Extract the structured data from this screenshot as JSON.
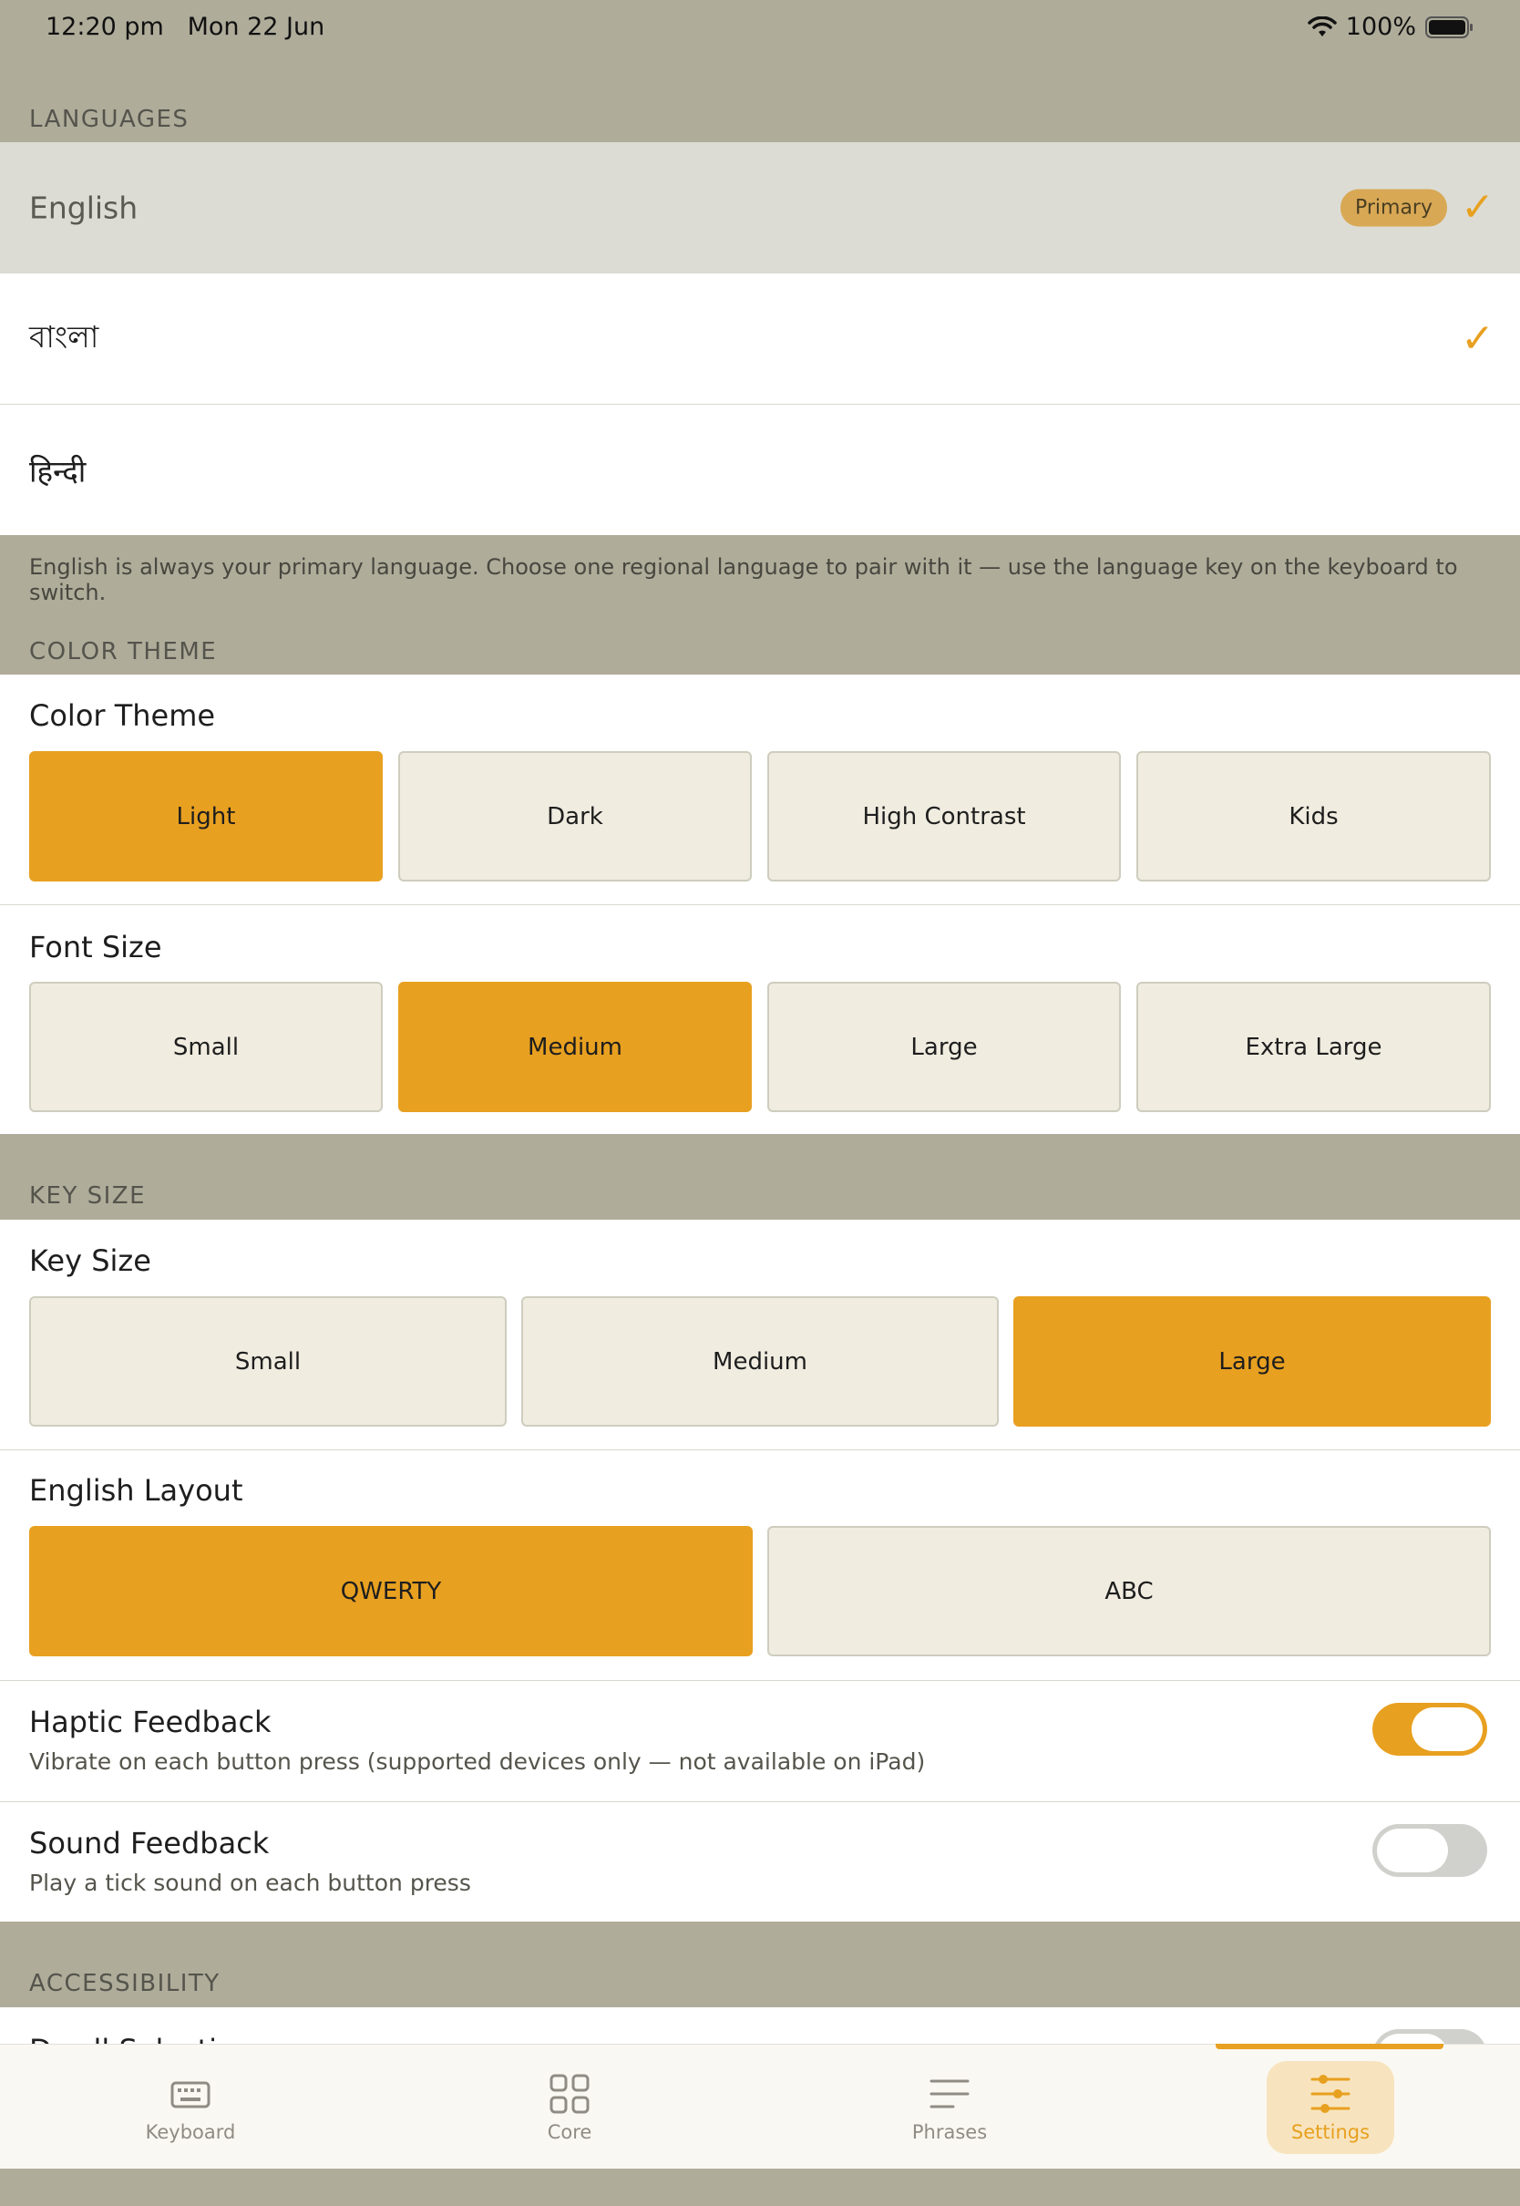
{
  "status_bar": {
    "time": "12:20 pm",
    "date": "Mon 22 Jun",
    "battery": "100%"
  },
  "languages": {
    "section_label": "LANGUAGES",
    "items": [
      {
        "name": "English",
        "badge": "Primary",
        "checked": true
      },
      {
        "name": "বাংলা",
        "checked": true
      },
      {
        "name": "हिन्दी",
        "checked": false
      }
    ],
    "check_glyph": "✓",
    "note": "English is always your primary language. Choose one regional language to pair with it — use the language key on the keyboard to switch."
  },
  "color_theme": {
    "section_label": "COLOR THEME",
    "title": "Color Theme",
    "options": [
      "Light",
      "Dark",
      "High Contrast",
      "Kids"
    ],
    "selected": "Light"
  },
  "font_size": {
    "title": "Font Size",
    "options": [
      "Small",
      "Medium",
      "Large",
      "Extra Large"
    ],
    "selected": "Medium"
  },
  "key_size": {
    "section_label": "KEY SIZE",
    "title": "Key Size",
    "options": [
      "Small",
      "Medium",
      "Large"
    ],
    "selected": "Large"
  },
  "english_layout": {
    "title": "English Layout",
    "options": [
      "QWERTY",
      "ABC"
    ],
    "selected": "QWERTY"
  },
  "haptic_feedback": {
    "title": "Haptic Feedback",
    "description": "Vibrate on each button press (supported devices only — not available on iPad)",
    "enabled": true
  },
  "sound_feedback": {
    "title": "Sound Feedback",
    "description": "Play a tick sound on each button press",
    "enabled": false
  },
  "accessibility": {
    "section_label": "ACCESSIBILITY",
    "partial_item": "Dwell Selection"
  },
  "tab_bar": {
    "items": [
      {
        "label": "Keyboard",
        "icon": "keyboard-icon",
        "active": false
      },
      {
        "label": "Core",
        "icon": "grid-icon",
        "active": false
      },
      {
        "label": "Phrases",
        "icon": "list-icon",
        "active": false
      },
      {
        "label": "Settings",
        "icon": "sliders-icon",
        "active": true
      }
    ]
  },
  "colors": {
    "accent": "#E8A020",
    "section_bg": "#AFAC9A",
    "button_bg": "#F0ECE0"
  }
}
